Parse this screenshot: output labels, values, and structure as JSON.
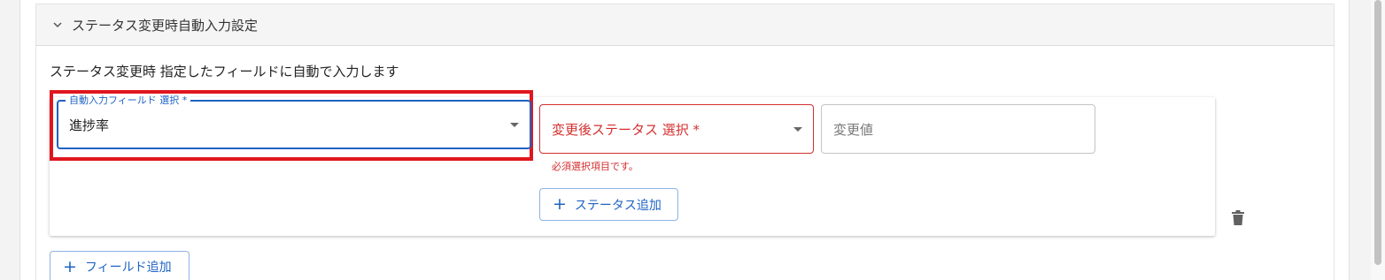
{
  "section": {
    "title": "ステータス変更時自動入力設定",
    "expand_icon": "chevron-down-icon"
  },
  "description": "ステータス変更時 指定したフィールドに自動で入力します",
  "auto_field": {
    "label": "自動入力フィールド 選択 *",
    "value": "進捗率"
  },
  "status_select": {
    "label": "変更後ステータス 選択 *",
    "error": "必須選択項目です。"
  },
  "change_value": {
    "placeholder": "変更値"
  },
  "buttons": {
    "add_status": "ステータス追加",
    "add_field": "フィールド追加"
  },
  "icons": {
    "delete": "trash-icon",
    "plus": "plus-icon",
    "dropdown": "caret-down-icon"
  },
  "colors": {
    "primary": "#1e63c3",
    "error": "#d32f2f",
    "highlight": "#e0161e"
  }
}
